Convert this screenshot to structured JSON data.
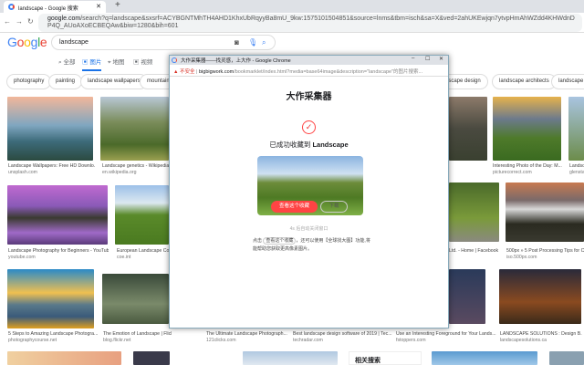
{
  "browser": {
    "tab_title": "landscape - Google 搜索",
    "url_host": "google.com",
    "url_rest": "/search?q=landscape&sxsrf=ACYBGNTMhTH4AHD1KhxUbRqyyBa8mU_9kw:1575101504851&source=lnms&tbm=isch&sa=X&ved=2ahUKEwjqn7ytvpHmAhWZdd4KHWdnDP4Q_AUoAXoECBEQAw&biw=1280&bih=601"
  },
  "google": {
    "logo": "Google",
    "query": "landscape",
    "tabs": [
      "全部",
      "图片",
      "地图",
      "视频"
    ],
    "chips": [
      "photography",
      "painting",
      "landscape wallpapers",
      "mountain",
      "landscape design",
      "landscape architects",
      "landscape a"
    ]
  },
  "results": [
    {
      "t": "Landscape Wallpapers: Free HD Downlo...",
      "s": "unsplash.com"
    },
    {
      "t": "Landscape genetics - Wikipedia",
      "s": "en.wikipedia.org"
    },
    {
      "t": "Interesting Photo of the Day: M...",
      "s": "picturecorrect.com"
    },
    {
      "t": "Landsc...",
      "s": "glensta..."
    },
    {
      "t": "Landscape Photography for Beginners - YouTube",
      "s": "youtube.com"
    },
    {
      "t": "European Landscape Conv...",
      "s": "coe.int"
    },
    {
      "t": "Ltd. - Home | Facebook",
      "s": ""
    },
    {
      "t": "500px » 5 Post Processing Tips for Crea...",
      "s": "iso.500px.com"
    },
    {
      "t": "5 Steps to Amazing Landscape Photogra...",
      "s": "photographycourse.net"
    },
    {
      "t": "The Emotion of Landscape | Flickr Blog",
      "s": "blog.flickr.net"
    },
    {
      "t": "The Ultimate Landscape Photograph...",
      "s": "121clicks.com"
    },
    {
      "t": "Best landscape design software of 2019 | Tec...",
      "s": "techradar.com"
    },
    {
      "t": "Use an Interesting Foreground for Your Lands...",
      "s": "fstoppers.com"
    },
    {
      "t": "LANDSCAPE SOLUTIONS : Design B...",
      "s": "landscapesolutions.ca"
    }
  ],
  "related": "相关搜索",
  "popup": {
    "window_title": "大作采集器——找灵感，上大作 - Google Chrome",
    "insecure": "不安全",
    "url_host": "bigbigwork.com",
    "url_rest": "/bookmarklet/index.html?media=base64image&description=\"landscape\"的图片搜索...",
    "heading": "大作采集器",
    "success_prefix": "已成功收藏到",
    "board": "Landscape",
    "view_button": "查看这个收藏",
    "download_button": "下载",
    "auto_close": "4s 后自动关闭窗口",
    "hint_prefix": "点击",
    "hint_pill": "查看这个收藏",
    "hint_suffix": "，还可以使用【全球找大图】功能,将能帮助您获取更高像素图片。"
  }
}
